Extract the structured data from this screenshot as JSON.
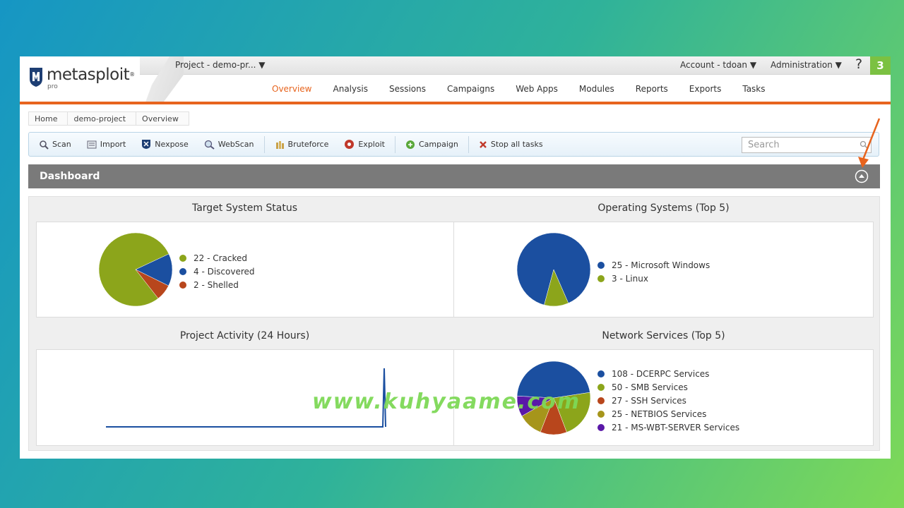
{
  "header": {
    "logo_text": "metasploit",
    "logo_reg": "®",
    "logo_sub": "pro",
    "project_select": "Project - demo-pr... ▼",
    "account_menu": "Account - tdoan ▼",
    "admin_menu": "Administration ▼",
    "help": "?",
    "notification_count": "3"
  },
  "nav": {
    "items": [
      "Overview",
      "Analysis",
      "Sessions",
      "Campaigns",
      "Web Apps",
      "Modules",
      "Reports",
      "Exports",
      "Tasks"
    ],
    "active": "Overview",
    "accent_color": "#e7641e"
  },
  "breadcrumb": [
    "Home",
    "demo-project",
    "Overview"
  ],
  "toolbar": {
    "scan": "Scan",
    "import": "Import",
    "nexpose": "Nexpose",
    "webscan": "WebScan",
    "bruteforce": "Bruteforce",
    "exploit": "Exploit",
    "campaign": "Campaign",
    "stop_all": "Stop all tasks",
    "search_placeholder": "Search"
  },
  "dashboard": {
    "title": "Dashboard",
    "panels": {
      "target_status": {
        "title": "Target System Status",
        "legend": [
          "22 - Cracked",
          "4 - Discovered",
          "2 - Shelled"
        ]
      },
      "os": {
        "title": "Operating Systems (Top 5)",
        "legend": [
          "25 - Microsoft Windows",
          "3 - Linux"
        ]
      },
      "activity": {
        "title": "Project Activity (24 Hours)"
      },
      "services": {
        "title": "Network Services (Top 5)",
        "legend": [
          "108 - DCERPC Services",
          "50 - SMB Services",
          "27 - SSH Services",
          "25 - NETBIOS Services",
          "21 - MS-WBT-SERVER Services"
        ]
      }
    }
  },
  "chart_data": [
    {
      "type": "pie",
      "title": "Target System Status",
      "slices": [
        {
          "label": "Cracked",
          "value": 22,
          "color": "#8ca51b"
        },
        {
          "label": "Discovered",
          "value": 4,
          "color": "#1b4fa0"
        },
        {
          "label": "Shelled",
          "value": 2,
          "color": "#b8461c"
        }
      ]
    },
    {
      "type": "pie",
      "title": "Operating Systems (Top 5)",
      "slices": [
        {
          "label": "Microsoft Windows",
          "value": 25,
          "color": "#1b4fa0"
        },
        {
          "label": "Linux",
          "value": 3,
          "color": "#8ca51b"
        }
      ]
    },
    {
      "type": "line",
      "title": "Project Activity (24 Hours)",
      "values": [
        0,
        0,
        0,
        0,
        0,
        0,
        0,
        0,
        0,
        0,
        0,
        0,
        0,
        0,
        0,
        0,
        0,
        0,
        0,
        0,
        0,
        0,
        0,
        28
      ],
      "ylim": [
        0,
        28
      ],
      "color": "#1b4fa0"
    },
    {
      "type": "pie",
      "title": "Network Services (Top 5)",
      "slices": [
        {
          "label": "DCERPC Services",
          "value": 108,
          "color": "#1b4fa0"
        },
        {
          "label": "SMB Services",
          "value": 50,
          "color": "#8ca51b"
        },
        {
          "label": "SSH Services",
          "value": 27,
          "color": "#b8461c"
        },
        {
          "label": "NETBIOS Services",
          "value": 25,
          "color": "#a6951b"
        },
        {
          "label": "MS-WBT-SERVER Services",
          "value": 21,
          "color": "#5a18a8"
        }
      ]
    }
  ],
  "watermark": "www.kuhyaame.com"
}
